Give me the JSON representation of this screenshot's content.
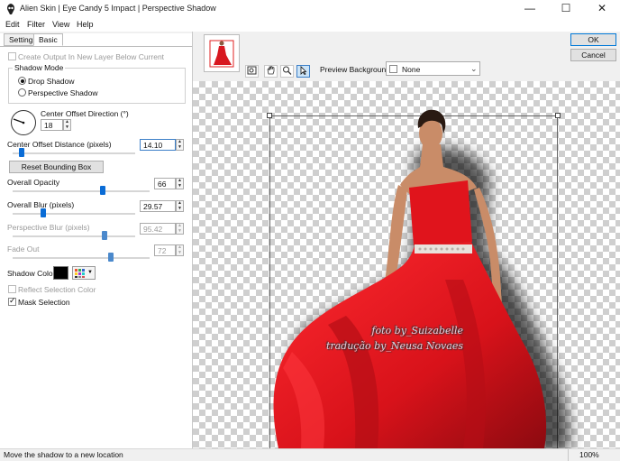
{
  "window": {
    "title": "Alien Skin | Eye Candy 5 Impact | Perspective Shadow",
    "minimize": "—",
    "maximize": "☐",
    "close": "✕"
  },
  "menu": {
    "edit": "Edit",
    "filter": "Filter",
    "view": "View",
    "help": "Help"
  },
  "tabs": {
    "settings": "Settings",
    "basic": "Basic"
  },
  "basic": {
    "create_output_label": "Create Output In New Layer Below Current",
    "shadow_mode": {
      "legend": "Shadow Mode",
      "drop_shadow": "Drop Shadow",
      "perspective_shadow": "Perspective Shadow",
      "selected": "Drop Shadow"
    },
    "center_offset_direction": {
      "label": "Center Offset Direction (°)",
      "value": "18"
    },
    "center_offset_distance": {
      "label": "Center Offset Distance (pixels)",
      "value": "14.10",
      "level": 0.07
    },
    "reset_bounding_box": "Reset Bounding Box",
    "overall_opacity": {
      "label": "Overall Opacity",
      "value": "66",
      "level": 0.66
    },
    "overall_blur": {
      "label": "Overall Blur (pixels)",
      "value": "29.57",
      "level": 0.25
    },
    "perspective_blur": {
      "label": "Perspective Blur (pixels)",
      "value": "95.42",
      "level": 0.75
    },
    "fade_out": {
      "label": "Fade Out",
      "value": "72",
      "level": 0.72
    },
    "shadow_color": {
      "label": "Shadow Color",
      "color": "#000000"
    },
    "reflect_selection_color": "Reflect Selection Color",
    "mask_selection": "Mask Selection"
  },
  "toolbar": {
    "preview_background_label": "Preview Background:",
    "preview_background_value": "None"
  },
  "buttons": {
    "ok": "OK",
    "cancel": "Cancel"
  },
  "watermark": {
    "line1": "foto by_Suizabelle",
    "line2": "tradução by_Neusa Novaes"
  },
  "status": {
    "message": "Move the shadow to a new location",
    "zoom": "100%"
  },
  "colors": {
    "dress": "#e0141c",
    "skin": "#c98c68",
    "accent": "#0a6cd6"
  }
}
